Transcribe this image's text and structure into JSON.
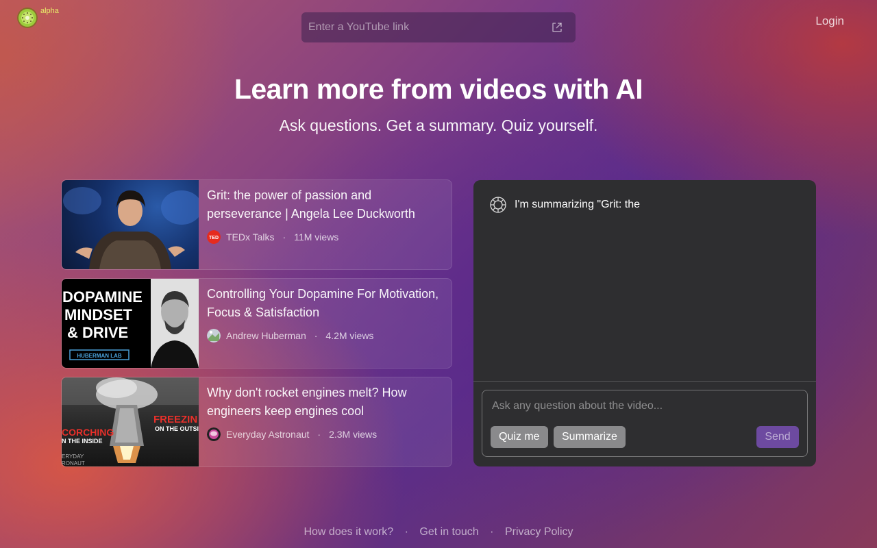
{
  "header": {
    "logo_icon": "kiwi-fruit-icon",
    "alpha_tag": "alpha",
    "url_input": {
      "placeholder": "Enter a YouTube link",
      "value": ""
    },
    "login_label": "Login"
  },
  "hero": {
    "title": "Learn more from videos with AI",
    "subtitle": "Ask questions. Get a summary. Quiz yourself."
  },
  "videos": [
    {
      "title": "Grit: the power of passion and perseverance | Angela Lee Duckworth",
      "channel": "TEDx Talks",
      "views": "11M views"
    },
    {
      "title": "Controlling Your Dopamine For Motivation, Focus & Satisfaction",
      "channel": "Andrew Huberman",
      "views": "4.2M views",
      "thumb_text": [
        "DOPAMINE",
        "MINDSET",
        "& DRIVE",
        "HUBERMAN LAB"
      ]
    },
    {
      "title": "Why don't rocket engines melt? How engineers keep engines cool",
      "channel": "Everyday Astronaut",
      "views": "2.3M views",
      "thumb_text": [
        "FREEZIN",
        "ON THE OUTSI",
        "CORCHING",
        "N THE INSIDE",
        "ERYDAY",
        "RONAUT"
      ]
    }
  ],
  "channel_badges": {
    "ted": "TED"
  },
  "chat": {
    "message": "I'm summarizing \"Grit: the",
    "input_placeholder": "Ask any question about the video...",
    "quiz_label": "Quiz me",
    "summarize_label": "Summarize",
    "send_label": "Send"
  },
  "footer": {
    "links": [
      "How does it work?",
      "Get in touch",
      "Privacy Policy"
    ],
    "separator": "·"
  },
  "colors": {
    "accent_purple": "#6d4aa0",
    "panel_bg": "#2e2e30",
    "alpha_yellow": "#e9ef6a"
  }
}
